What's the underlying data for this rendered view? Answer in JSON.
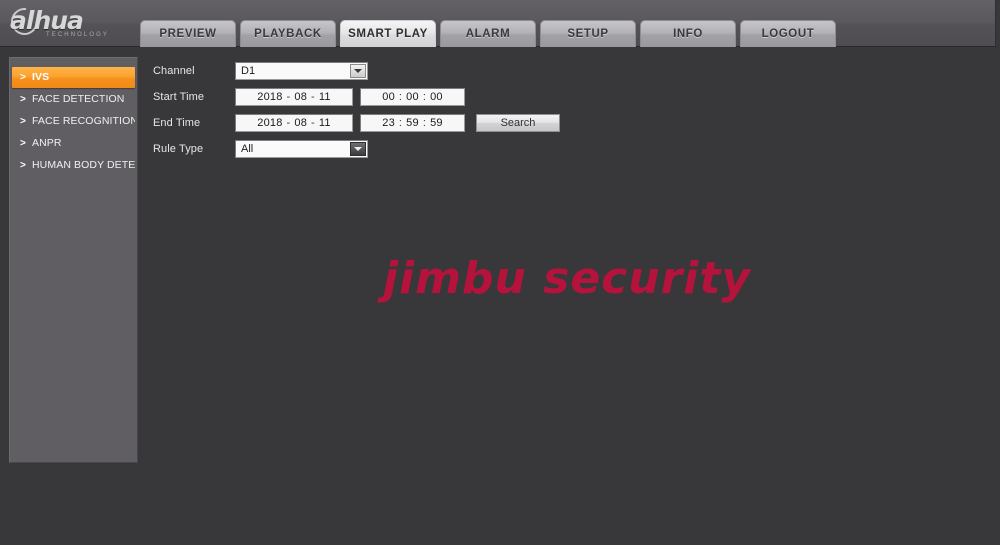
{
  "header": {
    "logo": {
      "word": "alhua",
      "sub": "TECHNOLOGY",
      "icon": "dahua-swoosh-icon"
    },
    "tabs": [
      {
        "label": "PREVIEW",
        "active": false
      },
      {
        "label": "PLAYBACK",
        "active": false
      },
      {
        "label": "SMART PLAY",
        "active": true
      },
      {
        "label": "ALARM",
        "active": false
      },
      {
        "label": "SETUP",
        "active": false
      },
      {
        "label": "INFO",
        "active": false
      },
      {
        "label": "LOGOUT",
        "active": false
      }
    ]
  },
  "sidebar": {
    "items": [
      {
        "label": "IVS",
        "active": true,
        "arrow": ">"
      },
      {
        "label": "FACE DETECTION",
        "active": false,
        "arrow": ">"
      },
      {
        "label": "FACE RECOGNITION",
        "active": false,
        "arrow": ">"
      },
      {
        "label": "ANPR",
        "active": false,
        "arrow": ">"
      },
      {
        "label": "HUMAN BODY DETE...",
        "active": false,
        "arrow": ">"
      }
    ]
  },
  "form": {
    "channel": {
      "label": "Channel",
      "value": "D1"
    },
    "start_time": {
      "label": "Start Time",
      "date": {
        "year": "2018",
        "month": "08",
        "day": "11",
        "sep": "-"
      },
      "time": {
        "hour": "00",
        "minute": "00",
        "second": "00",
        "sep": ":"
      }
    },
    "end_time": {
      "label": "End Time",
      "date": {
        "year": "2018",
        "month": "08",
        "day": "11",
        "sep": "-"
      },
      "time": {
        "hour": "23",
        "minute": "59",
        "second": "59",
        "sep": ":"
      }
    },
    "rule_type": {
      "label": "Rule Type",
      "value": "All"
    },
    "search_button": "Search"
  },
  "watermark": {
    "text": "jimbu security",
    "color": "#b5133c"
  },
  "colors": {
    "page_background": "#38373a",
    "header_background": "#5a585c",
    "sidebar_background": "#605e63",
    "accent_highlight": "#f5921c",
    "active_tab": "#e7e7e8",
    "watermark": "#b5133c"
  }
}
